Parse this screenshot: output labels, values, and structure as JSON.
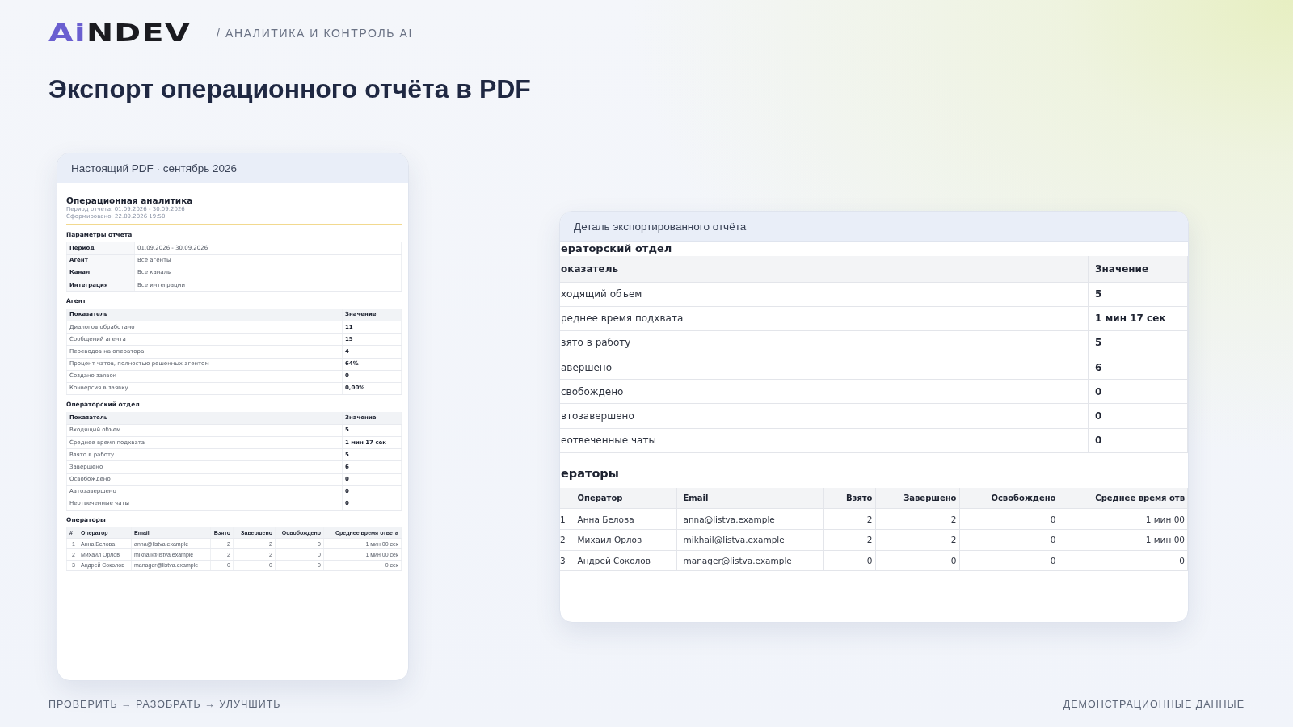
{
  "header": {
    "logo": {
      "accent": "Ai",
      "rest": "NDEV"
    },
    "section": "/ АНАЛИТИКА И КОНТРОЛЬ AI"
  },
  "title": "Экспорт операционного отчёта в PDF",
  "pdf_card": {
    "caption": "Настоящий PDF · сентябрь 2026",
    "document": {
      "title": "Операционная аналитика",
      "meta": [
        "Период отчета: 01.09.2026 - 30.09.2026",
        "Сформировано: 22.09.2026 19:50"
      ],
      "parameters": {
        "heading": "Параметры отчета",
        "rows": [
          {
            "label": "Период",
            "value": "01.09.2026 - 30.09.2026"
          },
          {
            "label": "Агент",
            "value": "Все агенты"
          },
          {
            "label": "Канал",
            "value": "Все каналы"
          },
          {
            "label": "Интеграция",
            "value": "Все интеграции"
          }
        ]
      },
      "sections": [
        {
          "heading": "Агент",
          "columns": [
            "Показатель",
            "Значение"
          ],
          "rows": [
            [
              "Диалогов обработано",
              "11"
            ],
            [
              "Сообщений агента",
              "15"
            ],
            [
              "Переводов на оператора",
              "4"
            ],
            [
              "Процент чатов, полностью решенных агентом",
              "64%"
            ],
            [
              "Создано заявок",
              "0"
            ],
            [
              "Конверсия в заявку",
              "0,00%"
            ]
          ]
        },
        {
          "heading": "Операторский отдел",
          "columns": [
            "Показатель",
            "Значение"
          ],
          "rows": [
            [
              "Входящий объем",
              "5"
            ],
            [
              "Среднее время подхвата",
              "1 мин 17 сек"
            ],
            [
              "Взято в работу",
              "5"
            ],
            [
              "Завершено",
              "6"
            ],
            [
              "Освобождено",
              "0"
            ],
            [
              "Автозавершено",
              "0"
            ],
            [
              "Неотвеченные чаты",
              "0"
            ]
          ]
        }
      ],
      "operators": {
        "heading": "Операторы",
        "columns": [
          "#",
          "Оператор",
          "Email",
          "Взято",
          "Завершено",
          "Освобождено",
          "Среднее время ответа"
        ],
        "rows": [
          [
            "1",
            "Анна Белова",
            "anna@listva.example",
            "2",
            "2",
            "0",
            "1 мин 00 сек"
          ],
          [
            "2",
            "Михаил Орлов",
            "mikhail@listva.example",
            "2",
            "2",
            "0",
            "1 мин 00 сек"
          ],
          [
            "3",
            "Андрей Соколов",
            "manager@listva.example",
            "0",
            "0",
            "0",
            "0 сек"
          ]
        ]
      }
    }
  },
  "detail_card": {
    "caption": "Деталь экспортированного отчёта",
    "section": {
      "heading": "ераторский отдел",
      "columns": [
        "оказатель",
        "Значение"
      ],
      "rows": [
        [
          "ходящий объем",
          "5"
        ],
        [
          "реднее время подхвата",
          "1 мин 17 сек"
        ],
        [
          "зято в работу",
          "5"
        ],
        [
          "авершено",
          "6"
        ],
        [
          "свобождено",
          "0"
        ],
        [
          "втозавершено",
          "0"
        ],
        [
          "еотвеченные чаты",
          "0"
        ]
      ]
    },
    "operators": {
      "heading": "ераторы",
      "columns": [
        "",
        "Оператор",
        "Email",
        "Взято",
        "Завершено",
        "Освобождено",
        "Среднее время отв"
      ],
      "rows": [
        [
          "1",
          "Анна Белова",
          "anna@listva.example",
          "2",
          "2",
          "0",
          "1 мин 00"
        ],
        [
          "2",
          "Михаил Орлов",
          "mikhail@listva.example",
          "2",
          "2",
          "0",
          "1 мин 00"
        ],
        [
          "3",
          "Андрей Соколов",
          "manager@listva.example",
          "0",
          "0",
          "0",
          "0"
        ]
      ]
    }
  },
  "footer": {
    "left": "ПРОВЕРИТЬ → РАЗОБРАТЬ → УЛУЧШИТЬ",
    "right": "ДЕМОНСТРАЦИОННЫЕ ДАННЫЕ"
  }
}
